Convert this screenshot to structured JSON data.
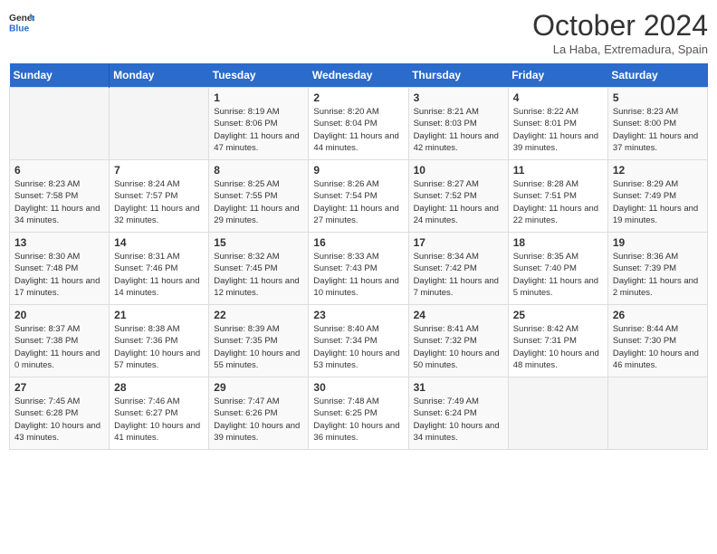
{
  "logo": {
    "general": "General",
    "blue": "Blue"
  },
  "title": "October 2024",
  "subtitle": "La Haba, Extremadura, Spain",
  "days_of_week": [
    "Sunday",
    "Monday",
    "Tuesday",
    "Wednesday",
    "Thursday",
    "Friday",
    "Saturday"
  ],
  "weeks": [
    [
      {
        "day": "",
        "info": ""
      },
      {
        "day": "",
        "info": ""
      },
      {
        "day": "1",
        "sunrise": "Sunrise: 8:19 AM",
        "sunset": "Sunset: 8:06 PM",
        "daylight": "Daylight: 11 hours and 47 minutes."
      },
      {
        "day": "2",
        "sunrise": "Sunrise: 8:20 AM",
        "sunset": "Sunset: 8:04 PM",
        "daylight": "Daylight: 11 hours and 44 minutes."
      },
      {
        "day": "3",
        "sunrise": "Sunrise: 8:21 AM",
        "sunset": "Sunset: 8:03 PM",
        "daylight": "Daylight: 11 hours and 42 minutes."
      },
      {
        "day": "4",
        "sunrise": "Sunrise: 8:22 AM",
        "sunset": "Sunset: 8:01 PM",
        "daylight": "Daylight: 11 hours and 39 minutes."
      },
      {
        "day": "5",
        "sunrise": "Sunrise: 8:23 AM",
        "sunset": "Sunset: 8:00 PM",
        "daylight": "Daylight: 11 hours and 37 minutes."
      }
    ],
    [
      {
        "day": "6",
        "sunrise": "Sunrise: 8:23 AM",
        "sunset": "Sunset: 7:58 PM",
        "daylight": "Daylight: 11 hours and 34 minutes."
      },
      {
        "day": "7",
        "sunrise": "Sunrise: 8:24 AM",
        "sunset": "Sunset: 7:57 PM",
        "daylight": "Daylight: 11 hours and 32 minutes."
      },
      {
        "day": "8",
        "sunrise": "Sunrise: 8:25 AM",
        "sunset": "Sunset: 7:55 PM",
        "daylight": "Daylight: 11 hours and 29 minutes."
      },
      {
        "day": "9",
        "sunrise": "Sunrise: 8:26 AM",
        "sunset": "Sunset: 7:54 PM",
        "daylight": "Daylight: 11 hours and 27 minutes."
      },
      {
        "day": "10",
        "sunrise": "Sunrise: 8:27 AM",
        "sunset": "Sunset: 7:52 PM",
        "daylight": "Daylight: 11 hours and 24 minutes."
      },
      {
        "day": "11",
        "sunrise": "Sunrise: 8:28 AM",
        "sunset": "Sunset: 7:51 PM",
        "daylight": "Daylight: 11 hours and 22 minutes."
      },
      {
        "day": "12",
        "sunrise": "Sunrise: 8:29 AM",
        "sunset": "Sunset: 7:49 PM",
        "daylight": "Daylight: 11 hours and 19 minutes."
      }
    ],
    [
      {
        "day": "13",
        "sunrise": "Sunrise: 8:30 AM",
        "sunset": "Sunset: 7:48 PM",
        "daylight": "Daylight: 11 hours and 17 minutes."
      },
      {
        "day": "14",
        "sunrise": "Sunrise: 8:31 AM",
        "sunset": "Sunset: 7:46 PM",
        "daylight": "Daylight: 11 hours and 14 minutes."
      },
      {
        "day": "15",
        "sunrise": "Sunrise: 8:32 AM",
        "sunset": "Sunset: 7:45 PM",
        "daylight": "Daylight: 11 hours and 12 minutes."
      },
      {
        "day": "16",
        "sunrise": "Sunrise: 8:33 AM",
        "sunset": "Sunset: 7:43 PM",
        "daylight": "Daylight: 11 hours and 10 minutes."
      },
      {
        "day": "17",
        "sunrise": "Sunrise: 8:34 AM",
        "sunset": "Sunset: 7:42 PM",
        "daylight": "Daylight: 11 hours and 7 minutes."
      },
      {
        "day": "18",
        "sunrise": "Sunrise: 8:35 AM",
        "sunset": "Sunset: 7:40 PM",
        "daylight": "Daylight: 11 hours and 5 minutes."
      },
      {
        "day": "19",
        "sunrise": "Sunrise: 8:36 AM",
        "sunset": "Sunset: 7:39 PM",
        "daylight": "Daylight: 11 hours and 2 minutes."
      }
    ],
    [
      {
        "day": "20",
        "sunrise": "Sunrise: 8:37 AM",
        "sunset": "Sunset: 7:38 PM",
        "daylight": "Daylight: 11 hours and 0 minutes."
      },
      {
        "day": "21",
        "sunrise": "Sunrise: 8:38 AM",
        "sunset": "Sunset: 7:36 PM",
        "daylight": "Daylight: 10 hours and 57 minutes."
      },
      {
        "day": "22",
        "sunrise": "Sunrise: 8:39 AM",
        "sunset": "Sunset: 7:35 PM",
        "daylight": "Daylight: 10 hours and 55 minutes."
      },
      {
        "day": "23",
        "sunrise": "Sunrise: 8:40 AM",
        "sunset": "Sunset: 7:34 PM",
        "daylight": "Daylight: 10 hours and 53 minutes."
      },
      {
        "day": "24",
        "sunrise": "Sunrise: 8:41 AM",
        "sunset": "Sunset: 7:32 PM",
        "daylight": "Daylight: 10 hours and 50 minutes."
      },
      {
        "day": "25",
        "sunrise": "Sunrise: 8:42 AM",
        "sunset": "Sunset: 7:31 PM",
        "daylight": "Daylight: 10 hours and 48 minutes."
      },
      {
        "day": "26",
        "sunrise": "Sunrise: 8:44 AM",
        "sunset": "Sunset: 7:30 PM",
        "daylight": "Daylight: 10 hours and 46 minutes."
      }
    ],
    [
      {
        "day": "27",
        "sunrise": "Sunrise: 7:45 AM",
        "sunset": "Sunset: 6:28 PM",
        "daylight": "Daylight: 10 hours and 43 minutes."
      },
      {
        "day": "28",
        "sunrise": "Sunrise: 7:46 AM",
        "sunset": "Sunset: 6:27 PM",
        "daylight": "Daylight: 10 hours and 41 minutes."
      },
      {
        "day": "29",
        "sunrise": "Sunrise: 7:47 AM",
        "sunset": "Sunset: 6:26 PM",
        "daylight": "Daylight: 10 hours and 39 minutes."
      },
      {
        "day": "30",
        "sunrise": "Sunrise: 7:48 AM",
        "sunset": "Sunset: 6:25 PM",
        "daylight": "Daylight: 10 hours and 36 minutes."
      },
      {
        "day": "31",
        "sunrise": "Sunrise: 7:49 AM",
        "sunset": "Sunset: 6:24 PM",
        "daylight": "Daylight: 10 hours and 34 minutes."
      },
      {
        "day": "",
        "info": ""
      },
      {
        "day": "",
        "info": ""
      }
    ]
  ]
}
